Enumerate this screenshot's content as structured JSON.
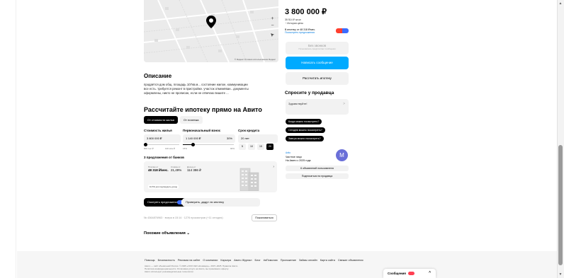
{
  "map": {
    "attribution": "© Яндекс Условия использования  Яндекс",
    "zoom_in": "+",
    "zoom_out": "−",
    "locate": "➤"
  },
  "description": {
    "title": "Описание",
    "text": "продаётся дом общ. площадь 107кв.м... состояние жилое, коммуникации все есть. требуется ремонт в пристройке. участок отмежёван.. документы оформлены, никто не прописан, если не отвечаю пишите ..."
  },
  "mortgage": {
    "title": "Рассчитайте ипотеку прямо на Авито",
    "tabs": [
      "От стоимости жилья",
      "От платежа"
    ],
    "labels": {
      "price": "Стоимость жилья",
      "down": "Первоначальный взнос",
      "term": "Срок кредита"
    },
    "price_value": "3 800 000 ₽",
    "down_value": "1 140 000 ₽",
    "down_pct": "30%",
    "term_value": "20 лет",
    "price_min": "800 тыс ₽",
    "price_max": "100 млн ₽",
    "down_min": "15%",
    "down_max": "90%",
    "price_fill": 0.04,
    "down_fill": 0.2,
    "terms": [
      "5",
      "10",
      "15",
      "20"
    ],
    "offers_title": "3 предложения от банков",
    "offer": {
      "label_payment": "Платёж от",
      "value_payment": "48 318 ₽/мес.",
      "label_rate": "Ставка от",
      "value_rate": "21,49%",
      "label_down": "Доход от",
      "value_down": "114 386 ₽",
      "note": "10,5% для подтвердить доход"
    },
    "btn_offers": "Смотреть предложения",
    "btn_family": "Проверить, дадут ли ипотеку"
  },
  "meta": {
    "line": "№ 4364876963 · вчера в 15:14 · 1276 просмотров (+11 сегодня)",
    "complain": "Пожаловаться"
  },
  "similar_title": "Похожие объявления ⌄",
  "footer": {
    "links": [
      "Помощь",
      "Безопасность",
      "Реклама на сайте",
      "О компании",
      "Карьера",
      "Авито Журнал",
      "Блог",
      "#яПомогаю",
      "Приложение",
      "Займы онлайн",
      "Карта сайта",
      "Свежие объявления"
    ],
    "legal": [
      "Авито — сайт объявлений России. © 2025 «ООО КЕХ еКоммерц». 2007–2025. Правила Авито.",
      "Политика конфиденциальности. Оплачивая услуги на Авито, вы принимаете оферту.",
      "Авито использует рекомендательные технологии."
    ],
    "messages": "Сообщения",
    "chevron": "^"
  },
  "sidebar": {
    "price": "3 800 000 ₽",
    "per_m": "35 514 ₽ за м²",
    "history": "◔ История цены",
    "mortgage_line": "В ипотеку от 48 318 ₽/мес.",
    "mortgage_link": "Посмотреть предложения",
    "call_btn": "Без звонков",
    "call_sub": "Пользователь предпочитает сообщения",
    "write_btn": "Написать сообщение",
    "calc_btn": "Рассчитать ипотеку",
    "ask_title": "Спросите у продавца",
    "ask_placeholder": "Здравствуйте!",
    "ask_arrow": ">",
    "chips": [
      "Когда можно посмотреть?",
      "Сегодня можно посмотреть?",
      "Завтра можно посмотреть?"
    ],
    "seller_tag": "Avito",
    "seller_name": "Частное лицо",
    "seller_since": "На Авито с 2025 года",
    "avatar": "M",
    "seller_btns": [
      "6 объявлений пользователя",
      "Подписаться на продавца"
    ]
  },
  "colors": {
    "accent": "#00aaff",
    "dark": "#000000",
    "chip_bg": "#f2f2f2",
    "avatar": "#6a6fd8",
    "badge_red": "#ff4053"
  }
}
